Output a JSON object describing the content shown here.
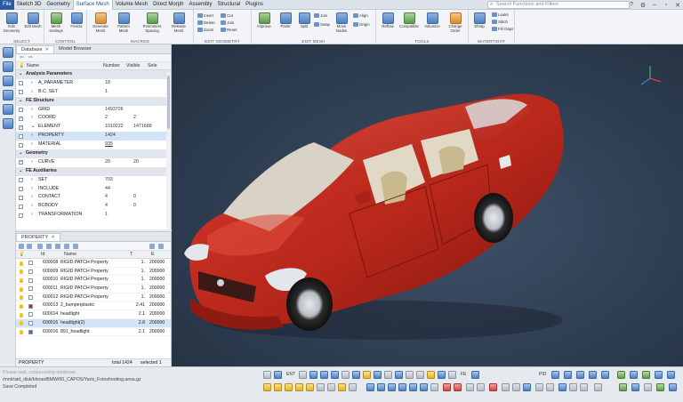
{
  "menubar": {
    "tabs": [
      "File",
      "Sketch 3D",
      "Geometry",
      "Surface Mesh",
      "Volume Mesh",
      "Direct Morph",
      "Assembly",
      "Structural",
      "Plugins"
    ],
    "search_placeholder": "Search Functions and Filters"
  },
  "ribbon": {
    "groups": {
      "select": "SELECT",
      "control": "CONTROL",
      "macros": "MACROS",
      "edit_geometry": "EDIT GEOMETRY",
      "edit_mesh": "EDIT MESH",
      "tools": "TOOLS",
      "watertight": "WATERTIGHT"
    },
    "buttons": {
      "edit_geometry": "Edit Geometry",
      "edit_mesh": "Edit Mesh",
      "mesh_settings": "Mesh Settings",
      "freeze": "Freeze",
      "generate_mesh": "Generate Mesh",
      "pattern_mesh": "Pattern Mesh",
      "perimeters_spacing": "Perimeters Spacing",
      "release_mesh": "Release Mesh",
      "insert": "Insert",
      "cut": "Cut",
      "delete": "Delete",
      "join": "Join",
      "zoom": "Zoom",
      "reset": "Reset",
      "improve": "Improve",
      "paste": "Paste",
      "split": "Split",
      "swap": "Swap",
      "move_nodes": "Move Nodes",
      "align": "Align",
      "origin": "Origin",
      "reflow": "Reflow",
      "compatible": "Compatible",
      "volumize": "Volumize",
      "change_order": "Change Order",
      "shrap": "Shrap",
      "leaks": "Leaks",
      "stitch": "Stitch",
      "fill_gaps": "Fill Gaps"
    }
  },
  "database": {
    "tabs": [
      "Database",
      "Model Browser"
    ],
    "columns": {
      "name": "Name",
      "number": "Number",
      "visible": "Visible",
      "sel": "Sele"
    },
    "rows": [
      {
        "label": "Analysis Parameters",
        "type": "section",
        "number": "",
        "visible": ""
      },
      {
        "label": "A_PARAMETER",
        "type": "item",
        "number": "18",
        "visible": ""
      },
      {
        "label": "B.C. SET",
        "type": "item",
        "number": "1",
        "visible": ""
      },
      {
        "label": "FE Structure",
        "type": "section",
        "number": "",
        "visible": ""
      },
      {
        "label": "GRID",
        "type": "item",
        "number": "1493726",
        "visible": ""
      },
      {
        "label": "COORD",
        "type": "item",
        "number": "2",
        "visible": "2"
      },
      {
        "label": "ELEMENT",
        "type": "item",
        "number": "1010222",
        "visible": "1471689"
      },
      {
        "label": "PROPERTY",
        "type": "item",
        "number": "1424",
        "visible": ""
      },
      {
        "label": "MATERIAL",
        "type": "item",
        "number": "935",
        "visible": ""
      },
      {
        "label": "Geometry",
        "type": "section",
        "number": "",
        "visible": ""
      },
      {
        "label": "CURVE",
        "type": "item",
        "number": "20",
        "visible": "20"
      },
      {
        "label": "FE Auxiliaries",
        "type": "section",
        "number": "",
        "visible": ""
      },
      {
        "label": "SET",
        "type": "item",
        "number": "703",
        "visible": ""
      },
      {
        "label": "INCLUDE",
        "type": "item",
        "number": "44",
        "visible": ""
      },
      {
        "label": "CONTACT",
        "type": "item",
        "number": "4",
        "visible": "0"
      },
      {
        "label": "BCBODY",
        "type": "item",
        "number": "4",
        "visible": "0"
      },
      {
        "label": "TRANSFORMATION",
        "type": "item",
        "number": "1",
        "visible": ""
      }
    ]
  },
  "property_panel": {
    "tab": "PROPERTY",
    "columns": {
      "id": "Id",
      "name": "Name",
      "t": "T",
      "extra": "E"
    },
    "rows": [
      {
        "id": "600008",
        "name": "RIGID PATCH Property",
        "t": "1.",
        "e": "200000"
      },
      {
        "id": "600009",
        "name": "RIGID PATCH Property",
        "t": "1.",
        "e": "200000"
      },
      {
        "id": "600010",
        "name": "RIGID PATCH Property",
        "t": "1.",
        "e": "200000"
      },
      {
        "id": "600011",
        "name": "RIGID PATCH Property",
        "t": "1.",
        "e": "200000"
      },
      {
        "id": "600012",
        "name": "RIGID PATCH Property",
        "t": "1.",
        "e": "200000"
      },
      {
        "id": "600013",
        "name": "2_bumperplastic",
        "t": "2.41",
        "e": "200000"
      },
      {
        "id": "600014",
        "name": "headlight",
        "t": "2.1",
        "e": "200000"
      },
      {
        "id": "600015",
        "name": "headlight(2)",
        "t": "2.8",
        "e": "200000"
      },
      {
        "id": "600016",
        "name": "891_headlight",
        "t": "2.1",
        "e": "200000"
      }
    ],
    "status_name": "PROPERTY",
    "total": "total 1424",
    "selected": "selected 1"
  },
  "messages": {
    "faded_line": "Please wait, compressing database...",
    "path": "/mnt/raid_disk/bloras/BMW/00_CAPOS/Yaris_Fotoshooting.ansa.gz",
    "status": "Save Completed"
  },
  "bottombar": {
    "ent": "ENT",
    "fe": "FE",
    "pid": "PID"
  },
  "colors": {
    "car_body": "#c0281c",
    "viewport_bg": "#2f3e52",
    "accent": "#2c5aa0"
  }
}
